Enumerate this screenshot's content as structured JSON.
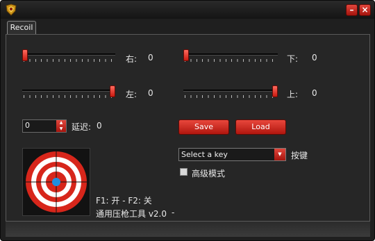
{
  "window": {
    "title_icon": "shield-logo-icon",
    "buttons": {
      "minimize_glyph": "–",
      "close_glyph": "×"
    }
  },
  "tabs": [
    {
      "label": "Recoil",
      "active": true
    }
  ],
  "sliders": {
    "right": {
      "label": "右:",
      "value": "0",
      "level": 0.0
    },
    "left": {
      "label": "左:",
      "value": "0",
      "level": 1.0
    },
    "down": {
      "label": "下:",
      "value": "0",
      "level": 0.0
    },
    "up": {
      "label": "上:",
      "value": "0",
      "level": 1.0
    }
  },
  "delay": {
    "input_value": "0",
    "label": "延迟:",
    "value": "0"
  },
  "buttons": {
    "save_label": "Save",
    "load_label": "Load"
  },
  "hotkey": {
    "selected": "Select a key",
    "label": "按键"
  },
  "advanced_mode": {
    "label": "高级模式",
    "checked": false
  },
  "status": {
    "shortcuts": "F1: 开 - F2: 关",
    "version": "通用压枪工具 v2.0",
    "trailer": "-"
  },
  "colors": {
    "accent": "#d7261b",
    "target_center": "#1e8fe0",
    "background": "#262626"
  }
}
